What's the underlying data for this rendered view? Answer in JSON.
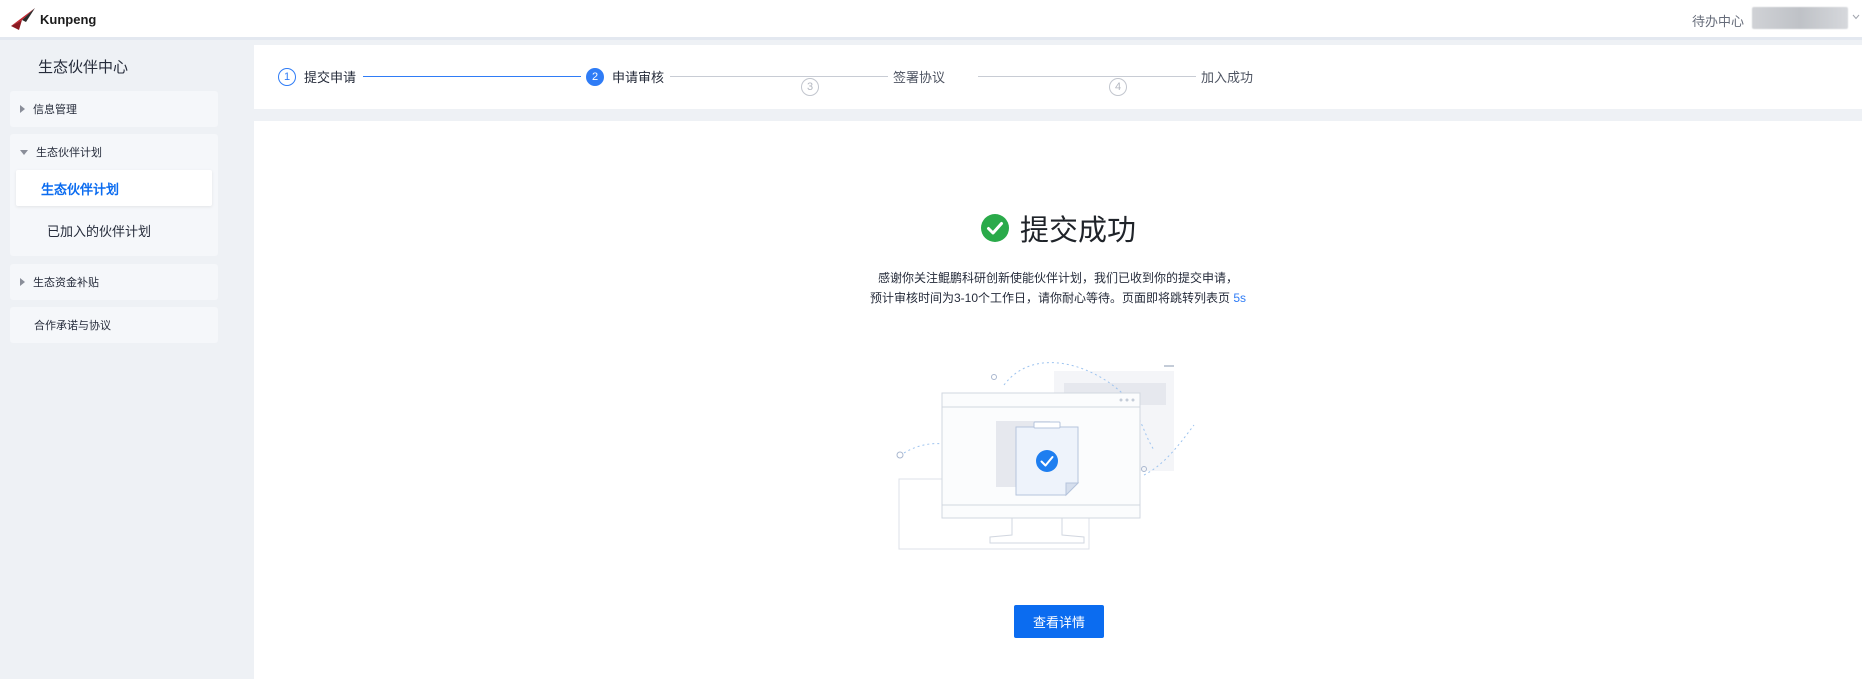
{
  "header": {
    "logo_text": "Kunpeng",
    "todo_label": "待办中心"
  },
  "sidebar": {
    "title": "生态伙伴中心",
    "groups": [
      {
        "label": "信息管理"
      },
      {
        "label": "生态伙伴计划",
        "items": [
          {
            "label": "生态伙伴计划"
          },
          {
            "label": "已加入的伙伴计划"
          }
        ]
      },
      {
        "label": "生态资金补贴"
      },
      {
        "label": "合作承诺与协议"
      }
    ]
  },
  "steps": [
    {
      "num": "1",
      "label": "提交申请"
    },
    {
      "num": "2",
      "label": "申请审核"
    },
    {
      "num": "3",
      "label": "签署协议"
    },
    {
      "num": "4",
      "label": "加入成功"
    }
  ],
  "result": {
    "title": "提交成功",
    "line1": "感谢你关注鲲鹏科研创新使能伙伴计划，我们已收到你的提交申请，",
    "line2": "预计审核时间为3-10个工作日，请你耐心等待。页面即将跳转列表页 ",
    "countdown": "5s",
    "button_label": "查看详情"
  },
  "colors": {
    "accent": "#0b6cf0",
    "success": "#2aaa4a",
    "background": "#eef1f5"
  }
}
